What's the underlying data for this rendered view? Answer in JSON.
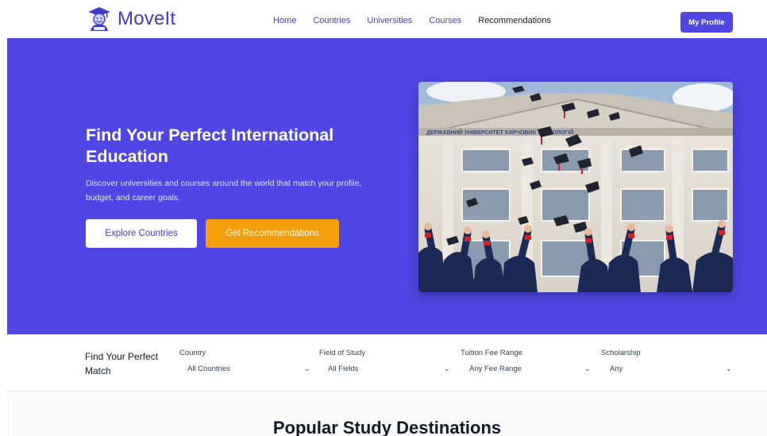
{
  "brand": {
    "name": "MoveIt",
    "icon": "graduate-mascot-icon"
  },
  "nav": {
    "items": [
      {
        "label": "Home"
      },
      {
        "label": "Countries"
      },
      {
        "label": "Universities"
      },
      {
        "label": "Courses"
      },
      {
        "label": "Recommendations"
      }
    ],
    "profile_button": "My Profile"
  },
  "hero": {
    "title": "Find Your Perfect International Education",
    "subtitle": "Discover universities and courses around the world that match your profile, budget, and career goals.",
    "primary_button": "Explore Countries",
    "secondary_button": "Get Recommendations",
    "image": "graduates-throwing-caps-photo"
  },
  "filters": {
    "title": "Find Your Perfect Match",
    "fields": [
      {
        "label": "Country",
        "value": "All Countries"
      },
      {
        "label": "Field of Study",
        "value": "All Fields"
      },
      {
        "label": "Tuition Fee Range",
        "value": "Any Fee Range"
      },
      {
        "label": "Scholarship",
        "value": "Any"
      }
    ]
  },
  "section": {
    "title": "Popular Study Destinations"
  },
  "colors": {
    "primary": "#4f46e5",
    "brand_text": "#4338ca",
    "accent": "#f59e0b",
    "section_bg": "#f9fafb"
  }
}
